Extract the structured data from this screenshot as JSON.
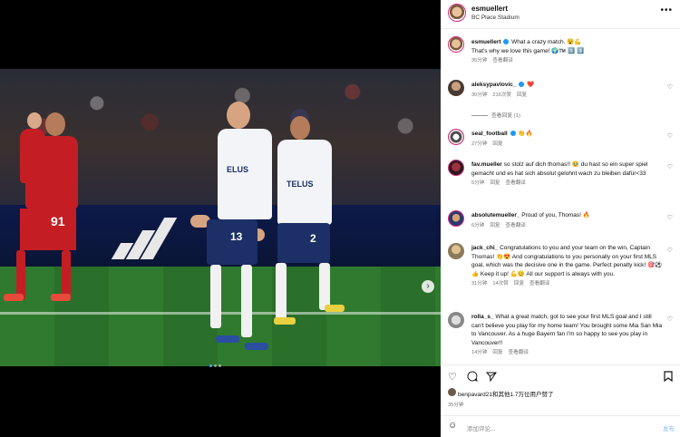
{
  "post": {
    "author": "esmuellert",
    "location": "BC Place Stadium"
  },
  "media": {
    "jersey_text_left": "ELUS",
    "jersey_text_right": "TELUS",
    "number_red": "91",
    "number_center": "13",
    "number_right": "2",
    "slide_count": 3,
    "active_slide": 1
  },
  "caption": {
    "user": "esmuellert",
    "text_line1": "What a crazy match. 😵💪",
    "text_line2": "That's why we love this game! 🌍™️ 1️⃣ 3️⃣",
    "time": "35分钟",
    "translate": "查看翻译"
  },
  "comments": [
    {
      "user": "aleksypavlovic_",
      "verified": true,
      "text": "❤️",
      "time": "30分钟",
      "likes": "216次赞",
      "reply": "回复",
      "view_replies": "查看回复 (1)"
    },
    {
      "user": "seal_football",
      "verified": true,
      "text": "👏🔥",
      "time": "27分钟",
      "reply": "回复"
    },
    {
      "user": "fav.mueller",
      "text": "so stolz auf dich thomas!! 🥹 du hast so ein super spiel gemacht und es hat sich absolut gelohnt wach zu bleiben dafür<33",
      "time": "5分钟",
      "reply": "回复",
      "translate": "查看翻译"
    },
    {
      "user": "absolutemueller_",
      "text": "Proud of you, Thomas! 🔥",
      "time": "6分钟",
      "reply": "回复",
      "translate": "查看翻译"
    },
    {
      "user": "jack_chi_",
      "text": "Congratulations to you and your team on the win, Captain Thomas! 👏😍 And congratulations to you personally on your first MLS goal, which was the decisive one in the game. Perfect penalty kick! 🎯⚽👍 Keep it up! 💪😊 All our support is always with you.",
      "time": "31分钟",
      "likes": "14次赞",
      "reply": "回复",
      "translate": "查看翻译"
    },
    {
      "user": "rolla_s_",
      "text": "What a great match, got to see your first MLS goal and I still can't believe you play for my home team! You brought some Mia San Mia to Vancouver. As a huge Bayern fan I'm so happy to see you play in Vancouver!!",
      "time": "14分钟",
      "reply": "回复",
      "translate": "查看翻译"
    }
  ],
  "likes_line": "benpavard21和其他1.7万位用户赞了",
  "post_time": "35分钟",
  "compose": {
    "placeholder": "添加评论...",
    "post_label": "发布"
  },
  "icons": {
    "more": "more-icon",
    "heart": "heart-icon",
    "comment": "comment-icon",
    "share": "share-icon",
    "save": "bookmark-icon",
    "emoji": "emoji-icon"
  }
}
